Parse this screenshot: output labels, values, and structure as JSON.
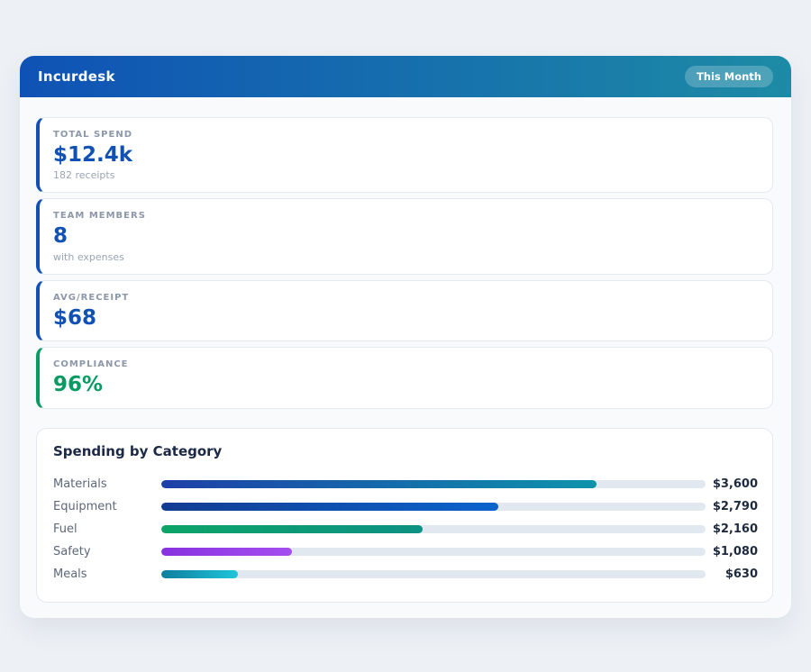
{
  "page": {
    "background_color": "#edf1f6",
    "surface_color": "#f8fafc"
  },
  "header": {
    "title": "Incurdesk",
    "badge_label": "This Month",
    "gradient_css": "linear-gradient(90deg, #0f52b5, #1d8ba5)"
  },
  "stats": [
    {
      "label": "TOTAL SPEND",
      "value": "$12.4k",
      "sub": "182 receipts",
      "accent_color": "#1251b4",
      "value_color": "#1251b4"
    },
    {
      "label": "TEAM MEMBERS",
      "value": "8",
      "sub": "with expenses",
      "accent_color": "#1251b4",
      "value_color": "#1251b4"
    },
    {
      "label": "AVG/RECEIPT",
      "value": "$68",
      "accent_color": "#1251b4",
      "value_color": "#1251b4"
    },
    {
      "label": "COMPLIANCE",
      "value": "96%",
      "accent_color": "#0a9a64",
      "value_color": "#099a62"
    }
  ],
  "chart_data": {
    "type": "bar",
    "orientation": "horizontal",
    "title": "Spending by Category",
    "categories": [
      "Materials",
      "Equipment",
      "Fuel",
      "Safety",
      "Meals"
    ],
    "values": [
      3600,
      2790,
      2160,
      1080,
      630
    ],
    "value_labels": [
      "$3,600",
      "$2,790",
      "$2,160",
      "$1,080",
      "$630"
    ],
    "xlim": [
      0,
      4500
    ],
    "grid": "off",
    "track_color": "#e2e8f0",
    "rows": [
      {
        "label": "Materials",
        "value_label": "$3,600",
        "width": "80%",
        "gradient": "linear-gradient(90deg, #1e3fa8, #0e93ab)"
      },
      {
        "label": "Equipment",
        "value_label": "$2,790",
        "width": "62%",
        "gradient": "linear-gradient(90deg, #123c92, #0b64cc)"
      },
      {
        "label": "Fuel",
        "value_label": "$2,160",
        "width": "48%",
        "gradient": "linear-gradient(90deg, #0ca468, #0d9184)"
      },
      {
        "label": "Safety",
        "value_label": "$1,080",
        "width": "24%",
        "gradient": "linear-gradient(90deg, #8832e0, #a44ef0)"
      },
      {
        "label": "Meals",
        "value_label": "$630",
        "width": "14%",
        "gradient": "linear-gradient(90deg, #0e7e9e, #1fc4da)"
      }
    ]
  }
}
